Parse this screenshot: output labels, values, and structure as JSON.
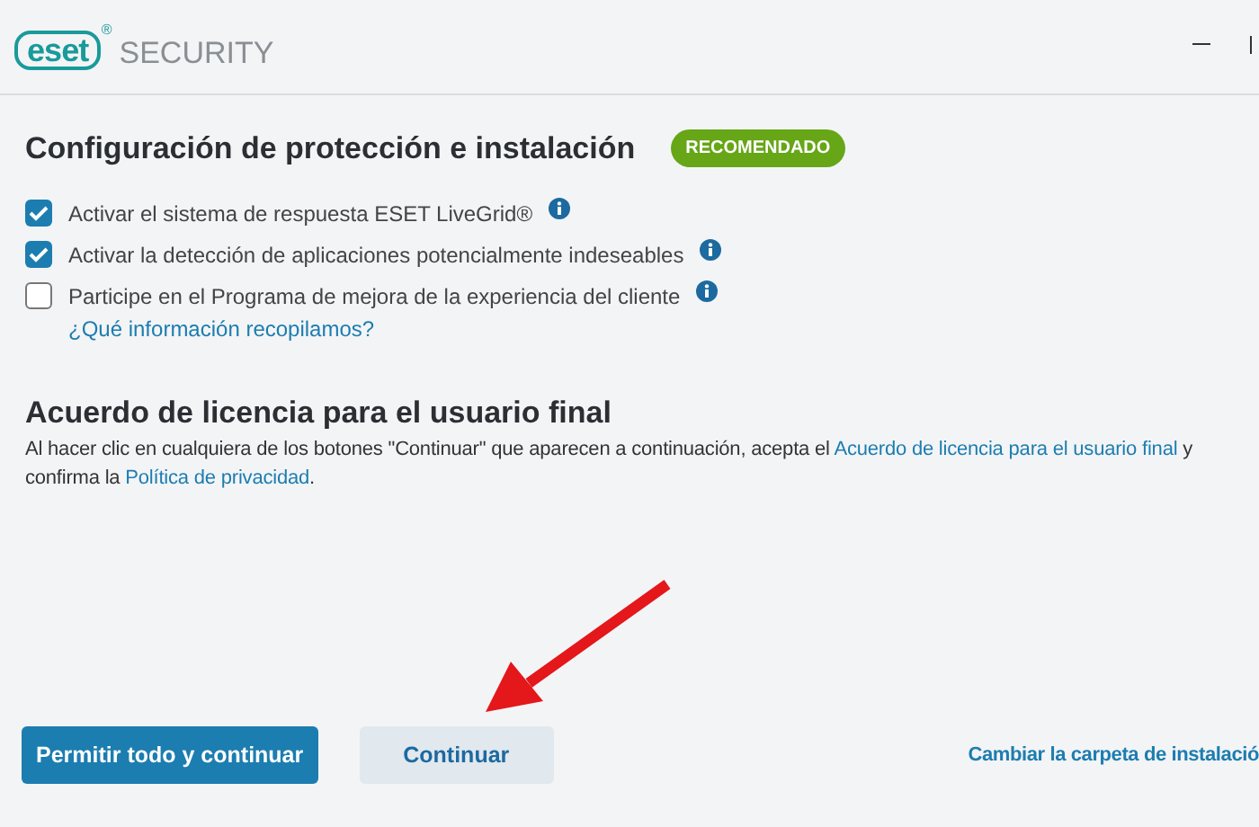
{
  "header": {
    "logo": "eset",
    "logo_mark": "®",
    "product": "SECURITY"
  },
  "setup": {
    "title": "Configuración de protección e instalación",
    "badge": "RECOMENDADO",
    "options": [
      {
        "label": "Activar el sistema de respuesta ESET LiveGrid®",
        "checked": true
      },
      {
        "label": "Activar la detección de aplicaciones potencialmente indeseables",
        "checked": true
      },
      {
        "label": "Participe en el Programa de mejora de la experiencia del cliente",
        "checked": false,
        "link": "¿Qué información recopilamos?"
      }
    ]
  },
  "license": {
    "title": "Acuerdo de licencia para el usuario final",
    "text_1": "Al hacer clic en cualquiera de los botones \"Continuar\" que aparecen a continuación, acepta el",
    "link_1": "Acuerdo de licencia para el usuario final",
    "text_2": "y confirma la",
    "link_2": "Política de privacidad",
    "text_3": "."
  },
  "buttons": [
    {
      "label": "Permitir todo y continuar",
      "kind": "primary"
    },
    {
      "label": "Continuar",
      "kind": "secondary"
    }
  ],
  "footer_link": "Cambiar la carpeta de instalació"
}
